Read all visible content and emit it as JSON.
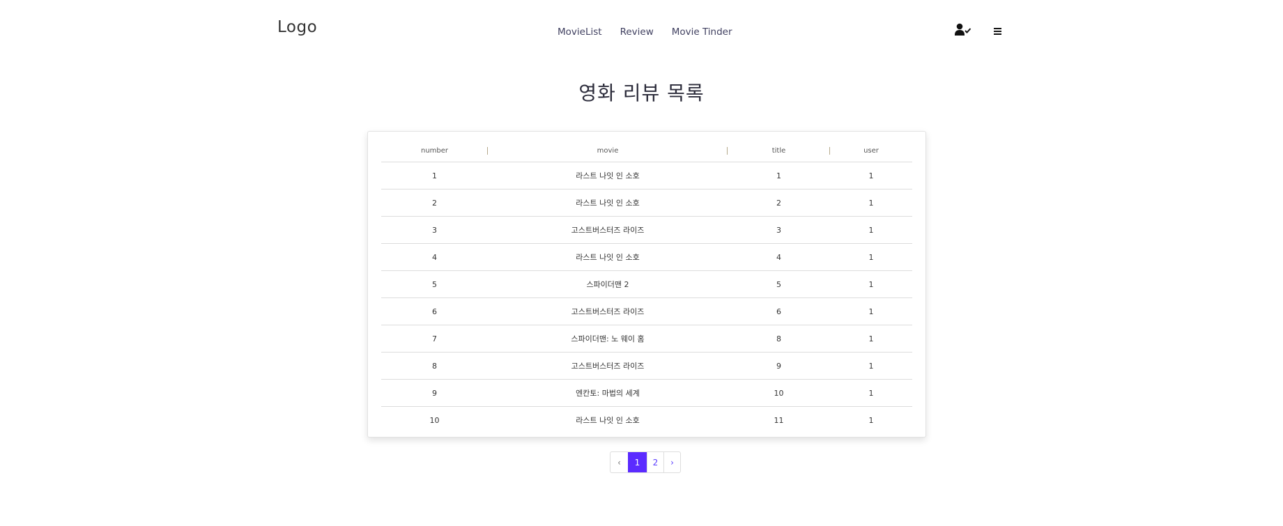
{
  "header": {
    "logo": "Logo",
    "nav": [
      "MovieList",
      "Review",
      "Movie Tinder"
    ]
  },
  "main": {
    "title": "영화 리뷰 목록",
    "table": {
      "columns": [
        "number",
        "movie",
        "title",
        "user"
      ],
      "rows": [
        [
          "1",
          "라스트 나잇 인 소호",
          "1",
          "1"
        ],
        [
          "2",
          "라스트 나잇 인 소호",
          "2",
          "1"
        ],
        [
          "3",
          "고스트버스터즈 라이즈",
          "3",
          "1"
        ],
        [
          "4",
          "라스트 나잇 인 소호",
          "4",
          "1"
        ],
        [
          "5",
          "스파이더맨 2",
          "5",
          "1"
        ],
        [
          "6",
          "고스트버스터즈 라이즈",
          "6",
          "1"
        ],
        [
          "7",
          "스파이더맨: 노 웨이 홈",
          "8",
          "1"
        ],
        [
          "8",
          "고스트버스터즈 라이즈",
          "9",
          "1"
        ],
        [
          "9",
          "엔칸토: 마법의 세계",
          "10",
          "1"
        ],
        [
          "10",
          "라스트 나잇 인 소호",
          "11",
          "1"
        ]
      ]
    },
    "pagination": {
      "prev": "‹",
      "pages": [
        "1",
        "2"
      ],
      "current": "1",
      "next": "›"
    }
  },
  "icons": {
    "user": "user-check-icon",
    "menu": "hamburger-menu-icon"
  },
  "colors": {
    "accent": "#5b2bff",
    "text": "#2b2b3a"
  }
}
